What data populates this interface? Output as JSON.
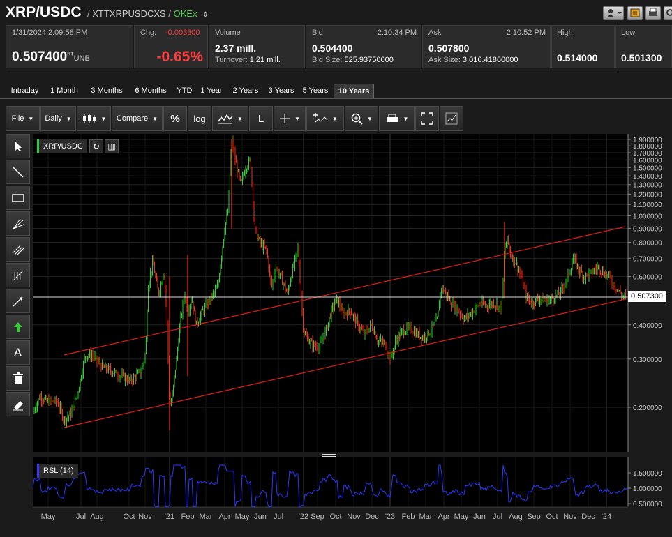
{
  "header": {
    "symbol": "XRP/USDC",
    "separator": "/",
    "code": "XTTXRPUSDCXS",
    "exchange": "OKEx",
    "exchange_caret": "⇕"
  },
  "quote": {
    "datetime": "1/31/2024  2:09:58 PM",
    "last": "0.507400",
    "last_sup": "RT",
    "last_unit": "UNB",
    "chg_label": "Chg.",
    "chg_value": "-0.003300",
    "chg_pct": "-0.65%",
    "volume_label": "Volume",
    "volume_value": "2.37 mill.",
    "turnover_label": "Turnover:",
    "turnover_value": "1.21 mill.",
    "bid_label": "Bid",
    "bid_time": "2:10:34 PM",
    "bid_value": "0.504400",
    "bid_size_label": "Bid Size:",
    "bid_size_value": "525.93750000",
    "ask_label": "Ask",
    "ask_time": "2:10:52 PM",
    "ask_value": "0.507800",
    "ask_size_label": "Ask Size:",
    "ask_size_value": "3,016.41860000",
    "high_label": "High",
    "high_value": "0.514000",
    "low_label": "Low",
    "low_value": "0.501300"
  },
  "ranges": [
    "Intraday",
    "1 Month",
    "3 Months",
    "6 Months",
    "YTD",
    "1 Year",
    "2 Years",
    "3 Years",
    "5 Years",
    "10 Years"
  ],
  "active_range": "10 Years",
  "toolbar": {
    "file": "File",
    "interval": "Daily",
    "compare": "Compare",
    "percent": "%",
    "log": "log",
    "line_tool": "L"
  },
  "chart": {
    "legend": "XRP/USDC",
    "price_tag": "0.507300",
    "rsi_legend": "RSL (14)",
    "y_ticks": [
      "1.900000",
      "1.800000",
      "1.700000",
      "1.600000",
      "1.500000",
      "1.400000",
      "1.300000",
      "1.200000",
      "1.100000",
      "1.000000",
      "0.900000",
      "0.800000",
      "0.700000",
      "0.600000",
      "0.400000",
      "0.300000",
      "0.200000"
    ],
    "rsi_ticks": [
      "1.500000",
      "1.000000",
      "0.500000"
    ],
    "x_labels": [
      "May",
      "Jul",
      "Aug",
      "Oct",
      "Nov",
      "'21",
      "Feb",
      "Mar",
      "Apr",
      "May",
      "Jun",
      "Jul",
      "'22",
      "Sep",
      "Oct",
      "Nov",
      "Dec",
      "'23",
      "Feb",
      "Mar",
      "Apr",
      "May",
      "Jun",
      "Jul",
      "Aug",
      "Sep",
      "Oct",
      "Nov",
      "Dec",
      "'24"
    ]
  },
  "colors": {
    "up": "#33cc33",
    "down": "#ee3322",
    "channel": "#e0201a",
    "rsi": "#2a3aff",
    "accent_green": "#4ccf4c",
    "negative": "#ff3b3b"
  }
}
